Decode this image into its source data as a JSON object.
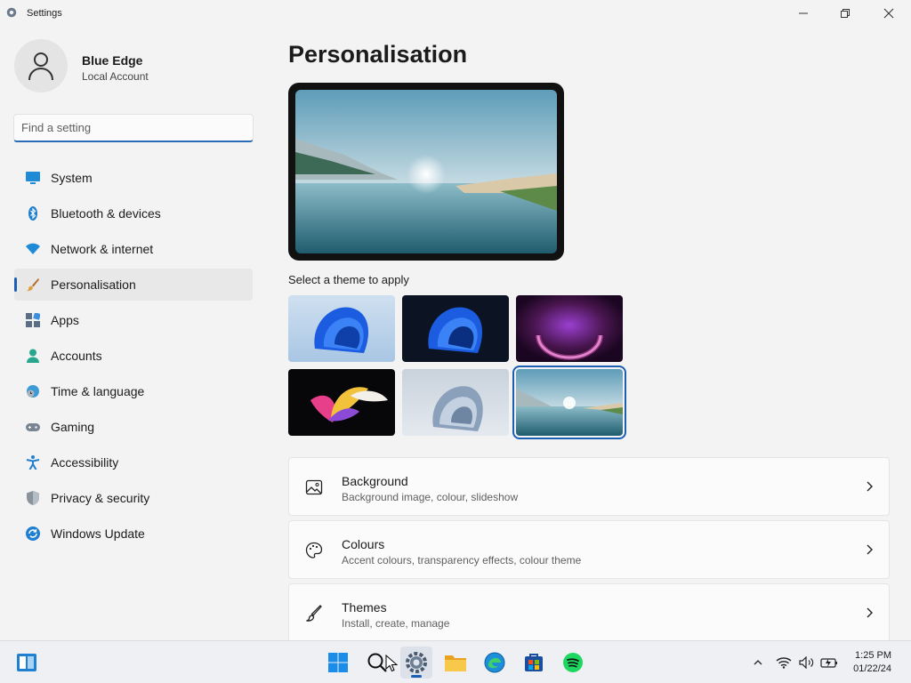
{
  "window": {
    "title": "Settings"
  },
  "profile": {
    "name": "Blue Edge",
    "account_type": "Local Account"
  },
  "search": {
    "placeholder": "Find a setting"
  },
  "nav": [
    {
      "label": "System",
      "icon": "system-icon"
    },
    {
      "label": "Bluetooth & devices",
      "icon": "bluetooth-icon"
    },
    {
      "label": "Network & internet",
      "icon": "wifi-icon"
    },
    {
      "label": "Personalisation",
      "icon": "brush-icon",
      "active": true
    },
    {
      "label": "Apps",
      "icon": "apps-icon"
    },
    {
      "label": "Accounts",
      "icon": "person-icon"
    },
    {
      "label": "Time & language",
      "icon": "globe-clock-icon"
    },
    {
      "label": "Gaming",
      "icon": "gamepad-icon"
    },
    {
      "label": "Accessibility",
      "icon": "accessibility-icon"
    },
    {
      "label": "Privacy & security",
      "icon": "shield-icon"
    },
    {
      "label": "Windows Update",
      "icon": "update-icon"
    }
  ],
  "main": {
    "title": "Personalisation",
    "theme_caption": "Select a theme to apply",
    "themes": [
      {
        "name": "windows-light"
      },
      {
        "name": "windows-dark"
      },
      {
        "name": "glow"
      },
      {
        "name": "captured-motion"
      },
      {
        "name": "flow"
      },
      {
        "name": "sunrise",
        "selected": true
      }
    ],
    "cards": [
      {
        "title": "Background",
        "subtitle": "Background image, colour, slideshow",
        "icon": "image-icon"
      },
      {
        "title": "Colours",
        "subtitle": "Accent colours, transparency effects, colour theme",
        "icon": "palette-icon"
      },
      {
        "title": "Themes",
        "subtitle": "Install, create, manage",
        "icon": "brush-icon"
      }
    ]
  },
  "taskbar": {
    "clock_time": "1:25 PM",
    "clock_date": "01/22/24"
  },
  "colors": {
    "accent": "#1a5fb4",
    "window_bg": "#f3f3f3",
    "card_bg": "#fbfbfb"
  }
}
